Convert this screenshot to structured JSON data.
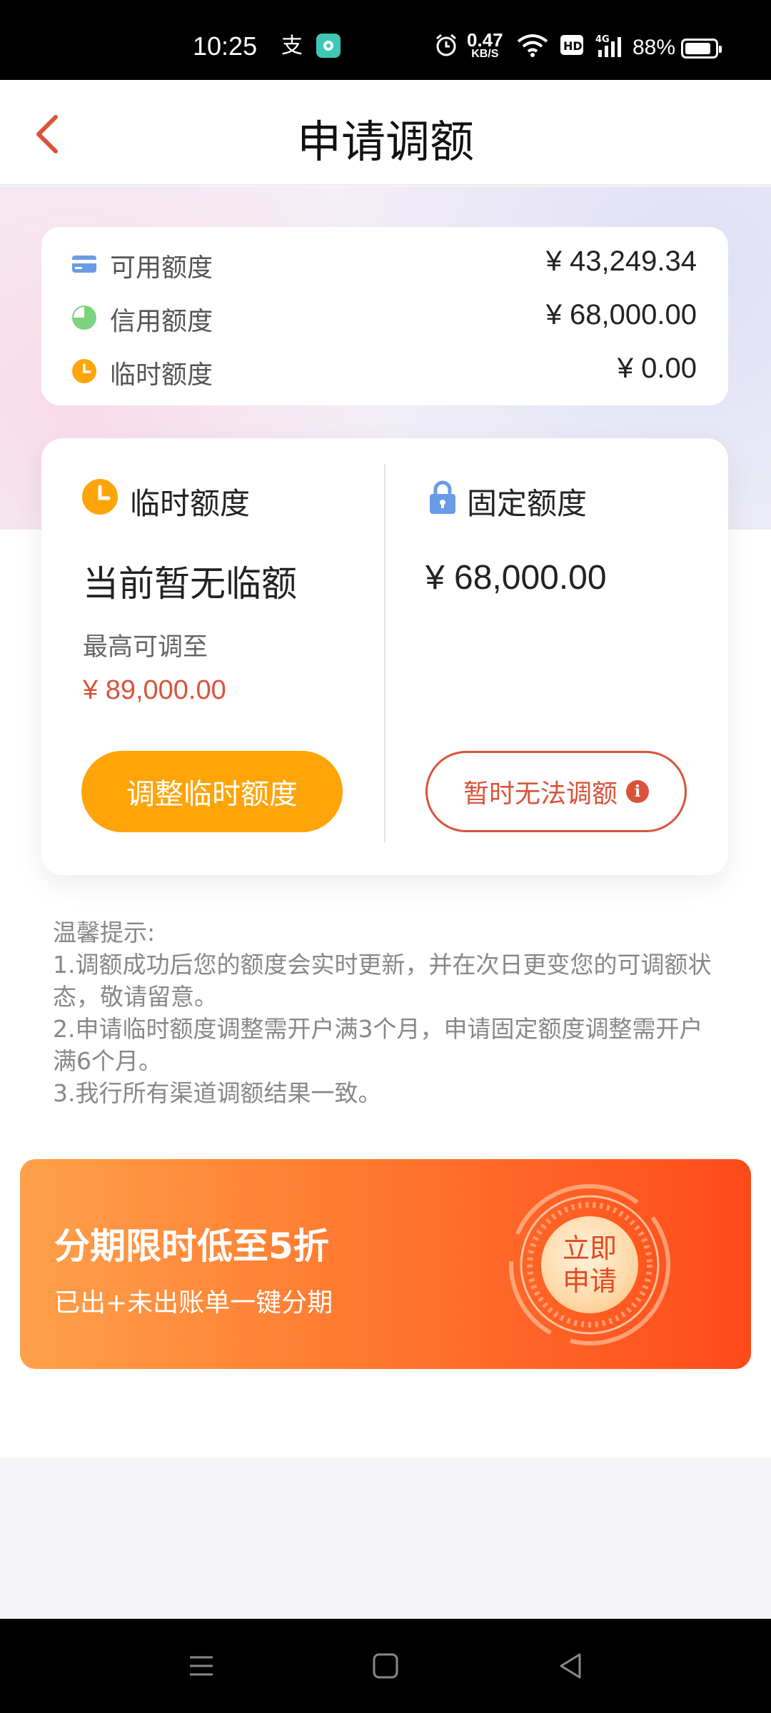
{
  "status_bar": {
    "time": "10:25",
    "net_speed_value": "0.47",
    "net_speed_unit": "KB/S",
    "hd": "HD",
    "network": "4G",
    "battery": "88%",
    "battery_level": 0.88
  },
  "header": {
    "title": "申请调额",
    "back_icon": "chevron-left-icon"
  },
  "summary": {
    "rows": [
      {
        "icon": "card-icon",
        "label": "可用额度",
        "value": "¥ 43,249.34"
      },
      {
        "icon": "pie-icon",
        "label": "信用额度",
        "value": "¥ 68,000.00"
      },
      {
        "icon": "clock-icon",
        "label": "临时额度",
        "value": "¥ 0.00"
      }
    ]
  },
  "temporary": {
    "title": "临时额度",
    "status": "当前暂无临额",
    "max_label": "最高可调至",
    "max_amount": "¥ 89,000.00",
    "button": "调整临时额度"
  },
  "fixed": {
    "title": "固定额度",
    "amount": "¥ 68,000.00",
    "button": "暂时无法调额",
    "info_glyph": "i"
  },
  "tips": {
    "heading": "温馨提示:",
    "lines": [
      "1.调额成功后您的额度会实时更新，并在次日更变您的可调额状态，敬请留意。",
      "2.申请临时额度调整需开户满3个月，申请固定额度调整需开户满6个月。",
      "3.我行所有渠道调额结果一致。"
    ]
  },
  "banner": {
    "title": "分期限时低至5折",
    "subtitle": "已出+未出账单一键分期",
    "cta_line1": "立即",
    "cta_line2": "申请"
  },
  "colors": {
    "accent_red": "#d9533b",
    "accent_orange": "#ffa50a",
    "icon_blue": "#6a9be6",
    "icon_green": "#7dd37f"
  }
}
